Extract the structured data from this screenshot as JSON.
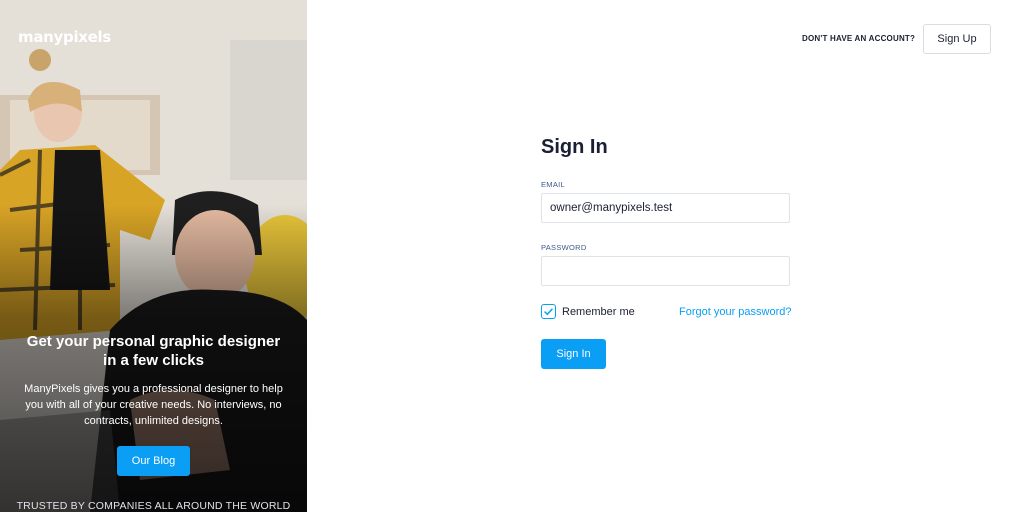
{
  "brand": {
    "logo_text": "manypixels",
    "accent": "#0a9ef5"
  },
  "hero": {
    "title": "Get your personal graphic designer in a few clicks",
    "description": "ManyPixels gives you a professional designer to help you with all of your creative needs. No interviews, no contracts, unlimited designs.",
    "blog_button": "Our Blog",
    "trusted_text": "TRUSTED BY COMPANIES ALL AROUND THE WORLD"
  },
  "header": {
    "no_account_text": "DON'T HAVE AN ACCOUNT?",
    "signup_button": "Sign Up"
  },
  "form": {
    "title": "Sign In",
    "email_label": "EMAIL",
    "email_value": "owner@manypixels.test",
    "password_label": "PASSWORD",
    "password_value": "",
    "remember_label": "Remember me",
    "remember_checked": true,
    "forgot_link": "Forgot your password?",
    "submit_button": "Sign In"
  },
  "icons": {
    "checkbox_check": "checkmark-icon"
  }
}
